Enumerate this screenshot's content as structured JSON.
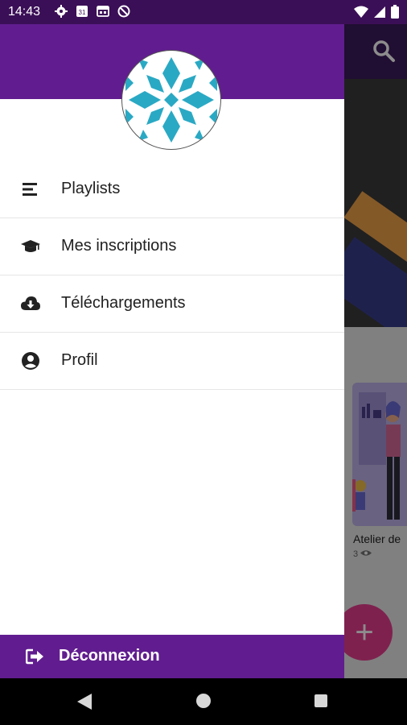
{
  "status_bar": {
    "time": "14:43",
    "icons": [
      "settings-gear-icon",
      "calendar-icon",
      "calendar-grid-icon",
      "do-not-disturb-icon"
    ],
    "calendar_day": "31",
    "right_icons": [
      "wifi-icon",
      "signal-icon",
      "battery-icon"
    ]
  },
  "colors": {
    "drawer_header": "#611d8f",
    "logout_bar": "#611d8f",
    "app_bar": "#3d1a5e",
    "fab": "#e83d8f",
    "avatar_pattern": "#2aa9c4"
  },
  "drawer": {
    "menu": [
      {
        "label": "Playlists",
        "icon": "playlist-icon"
      },
      {
        "label": "Mes inscriptions",
        "icon": "graduation-cap-icon"
      },
      {
        "label": "Téléchargements",
        "icon": "cloud-download-icon"
      },
      {
        "label": "Profil",
        "icon": "account-circle-icon"
      }
    ],
    "logout": {
      "label": "Déconnexion",
      "icon": "logout-icon"
    }
  },
  "background": {
    "card_title": "Atelier de",
    "card_views": "3",
    "fab_label": "+"
  }
}
